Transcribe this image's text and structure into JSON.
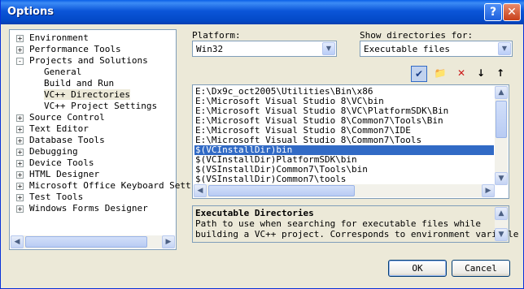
{
  "window": {
    "title": "Options",
    "help_glyph": "?",
    "close_glyph": "✕"
  },
  "tree": {
    "items": [
      {
        "label": "Environment",
        "expander": "+",
        "level": 0
      },
      {
        "label": "Performance Tools",
        "expander": "+",
        "level": 0
      },
      {
        "label": "Projects and Solutions",
        "expander": "-",
        "level": 0
      },
      {
        "label": "General",
        "expander": "",
        "level": 1
      },
      {
        "label": "Build and Run",
        "expander": "",
        "level": 1
      },
      {
        "label": "VC++ Directories",
        "expander": "",
        "level": 1,
        "selected": true
      },
      {
        "label": "VC++ Project Settings",
        "expander": "",
        "level": 1
      },
      {
        "label": "Source Control",
        "expander": "+",
        "level": 0
      },
      {
        "label": "Text Editor",
        "expander": "+",
        "level": 0
      },
      {
        "label": "Database Tools",
        "expander": "+",
        "level": 0
      },
      {
        "label": "Debugging",
        "expander": "+",
        "level": 0
      },
      {
        "label": "Device Tools",
        "expander": "+",
        "level": 0
      },
      {
        "label": "HTML Designer",
        "expander": "+",
        "level": 0
      },
      {
        "label": "Microsoft Office Keyboard Sett",
        "expander": "+",
        "level": 0
      },
      {
        "label": "Test Tools",
        "expander": "+",
        "level": 0
      },
      {
        "label": "Windows Forms Designer",
        "expander": "+",
        "level": 0
      }
    ]
  },
  "platform": {
    "label": "Platform:",
    "value": "Win32"
  },
  "show_dirs": {
    "label": "Show directories for:",
    "value": "Executable files"
  },
  "toolbar": {
    "check_icon": "✔",
    "folder_icon": "📁",
    "delete_icon": "✕",
    "down_icon": "↓",
    "up_icon": "↑"
  },
  "directories": [
    "E:\\Dx9c_oct2005\\Utilities\\Bin\\x86",
    "E:\\Microsoft Visual Studio 8\\VC\\bin",
    "E:\\Microsoft Visual Studio 8\\VC\\PlatformSDK\\Bin",
    "E:\\Microsoft Visual Studio 8\\Common7\\Tools\\Bin",
    "E:\\Microsoft Visual Studio 8\\Common7\\IDE",
    "E:\\Microsoft Visual Studio 8\\Common7\\Tools",
    "$(VCInstallDir)bin",
    "$(VCInstallDir)PlatformSDK\\bin",
    "$(VSInstallDir)Common7\\Tools\\bin",
    "$(VSInstallDir)Common7\\tools"
  ],
  "selected_directory_index": 6,
  "description": {
    "title": "Executable Directories",
    "line1": "Path to use when searching for executable files while",
    "line2": "building a VC++ project.  Corresponds to environment variable"
  },
  "buttons": {
    "ok": "OK",
    "cancel": "Cancel"
  },
  "scroll_glyphs": {
    "left": "◀",
    "right": "▶",
    "up": "▲",
    "down": "▼"
  },
  "colors": {
    "selection": "#316ac5",
    "titlebar": "#0a5fe8",
    "face": "#ece9d8"
  }
}
